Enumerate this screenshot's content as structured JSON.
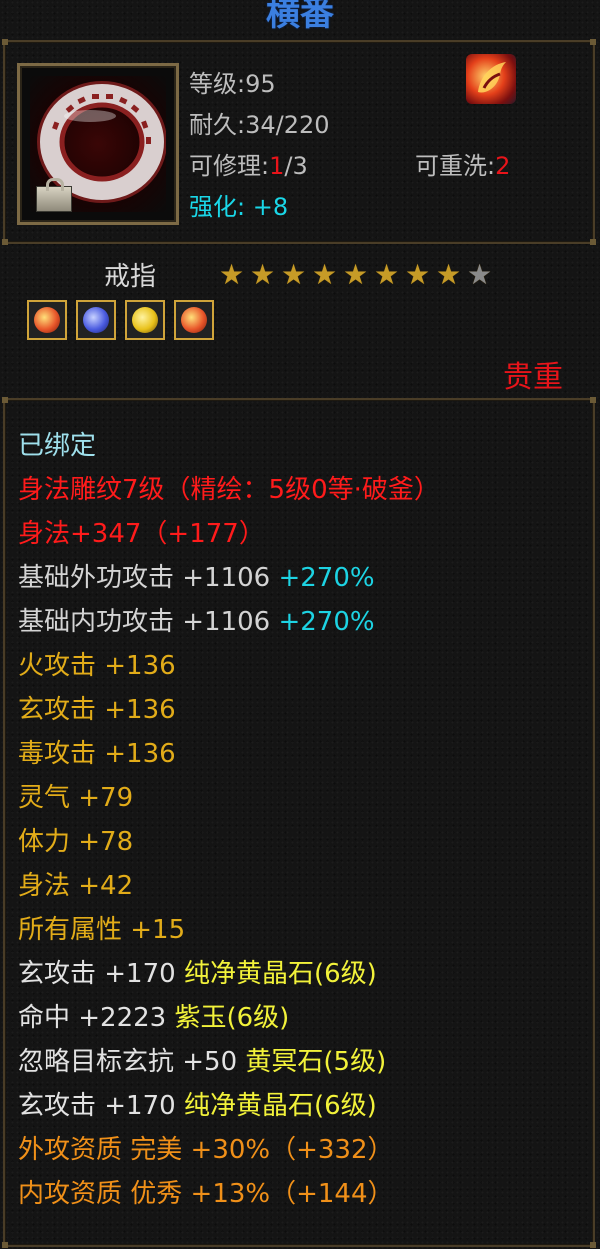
{
  "title": "横番",
  "item": {
    "level_label": "等级",
    "level_value": ":95",
    "durability_label": "耐久",
    "durability_value": ":34/220",
    "repair_label": "可修理:",
    "repair_current": "1",
    "repair_total": "/3",
    "rewash_label": "可重洗:",
    "rewash_value": "2",
    "enhance_label": "强化:",
    "enhance_value": "+8",
    "type": "戒指",
    "stars_filled": 8,
    "stars_total": 9,
    "rarity": "贵重",
    "icon": "bracelet-ring-icon",
    "badge_icon": "dragon-emblem-icon"
  },
  "gems": [
    {
      "icon": "fire-gem-icon",
      "color": "#e8562a"
    },
    {
      "icon": "blue-crystal-gem-icon",
      "color": "#4a5be0"
    },
    {
      "icon": "yellow-gem-icon",
      "color": "#e8c11a"
    },
    {
      "icon": "fire-gem-icon",
      "color": "#e8562a"
    }
  ],
  "stats": {
    "bound": "已绑定",
    "engrave": "身法雕纹7级（精绘：5级0等·破釜）",
    "shenfa_main": "身法+347（+177）",
    "base_outer_label": "基础外功攻击 +1106 ",
    "base_outer_pct": "+270%",
    "base_inner_label": "基础内功攻击 +1106 ",
    "base_inner_pct": "+270%",
    "fire_attack": "火攻击 +136",
    "xuan_attack": "玄攻击 +136",
    "poison_attack": "毒攻击 +136",
    "lingqi": "灵气 +79",
    "tili": "体力 +78",
    "shenfa": "身法 +42",
    "all_attr": "所有属性 +15",
    "gem1_stat": "玄攻击 +170 ",
    "gem1_name": "纯净黄晶石(6级)",
    "gem2_stat": "命中 +2223 ",
    "gem2_name": "紫玉(6级)",
    "gem3_stat": "忽略目标玄抗 +50 ",
    "gem3_name": "黄冥石(5级)",
    "gem4_stat": "玄攻击 +170 ",
    "gem4_name": "纯净黄晶石(6级)",
    "outer_quality": "外攻资质   完美 +30%（+332）",
    "inner_quality": "内攻资质   优秀 +13%（+144）"
  },
  "colors": {
    "title": "#3b7fe0",
    "red": "#ff1b1b",
    "cyan": "#1dd3e3",
    "gold": "#e2ac19",
    "yellow": "#f2f23a",
    "orange": "#f09019"
  }
}
